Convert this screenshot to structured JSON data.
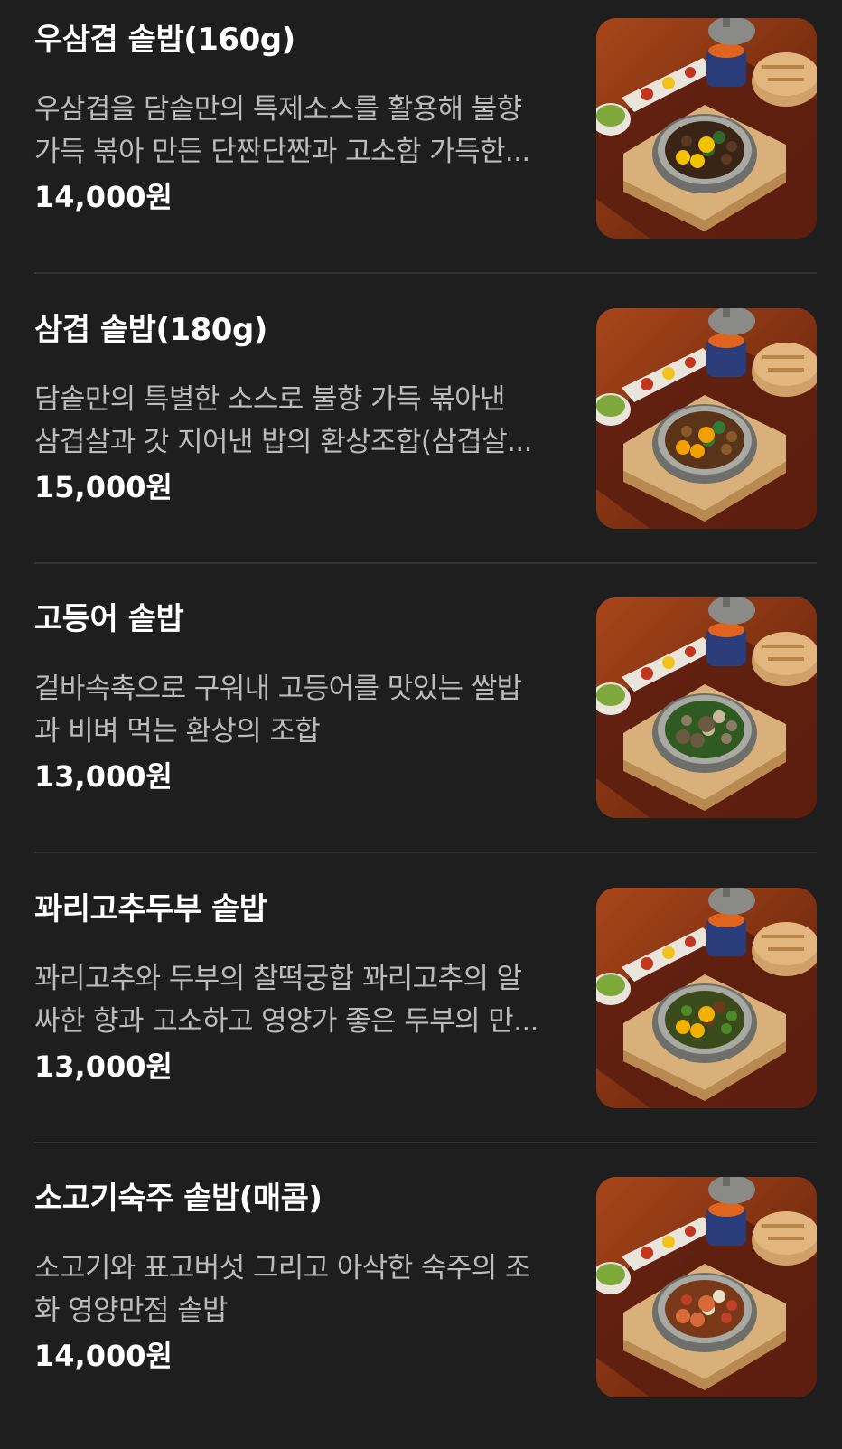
{
  "menu": {
    "items": [
      {
        "name": "우삼겹 솥밥(160g)",
        "desc_line1": "우삼겹을 담솥만의 특제소스를 활용해 불향",
        "desc_line2": "가득 볶아 만든 단짠단짠과 고소함 가득한...",
        "price": "14,000원",
        "image_icon": "dish-photo-icon",
        "topping": "beef"
      },
      {
        "name": "삼겹 솥밥(180g)",
        "desc_line1": "담솥만의 특별한 소스로 불향 가득 볶아낸",
        "desc_line2": "삼겹살과 갓 지어낸 밥의 환상조합(삼겹살...",
        "price": "15,000원",
        "image_icon": "dish-photo-icon",
        "topping": "pork"
      },
      {
        "name": "고등어 솥밥",
        "desc_line1": "겉바속촉으로 구워내 고등어를 맛있는 쌀밥",
        "desc_line2": "과 비벼 먹는 환상의 조합",
        "price": "13,000원",
        "image_icon": "dish-photo-icon",
        "topping": "mackerel"
      },
      {
        "name": "꽈리고추두부 솥밥",
        "desc_line1": "꽈리고추와 두부의 찰떡궁합 꽈리고추의 알",
        "desc_line2": "싸한 향과 고소하고 영양가 좋은 두부의 만...",
        "price": "13,000원",
        "image_icon": "dish-photo-icon",
        "topping": "pepper-tofu"
      },
      {
        "name": "소고기숙주 솥밥(매콤)",
        "desc_line1": "소고기와 표고버섯 그리고 아삭한 숙주의 조",
        "desc_line2": "화 영양만점 솥밥",
        "price": "14,000원",
        "image_icon": "dish-photo-icon",
        "topping": "beef-sprout"
      }
    ]
  },
  "colors": {
    "background": "#1e1e1e",
    "title": "#ffffff",
    "description": "#bcbcbc",
    "divider": "#333333"
  }
}
